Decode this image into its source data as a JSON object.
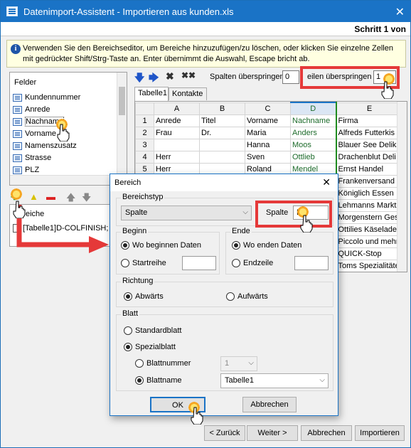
{
  "window": {
    "title": "Datenimport-Assistent -  Importieren aus  kunden.xls",
    "close": "✕",
    "step": "Schritt 1 von"
  },
  "info": {
    "text": "Verwenden Sie den Bereichseditor, um Bereiche hinzuzufügen/zu löschen, oder klicken Sie einzelne Zellen mit gedrückter Shift/Strg-Taste an. Enter übernimmt die Auswahl, Escape bricht ab."
  },
  "felder": {
    "header": "Felder",
    "items": [
      "Kundennummer",
      "Anrede",
      "Nachname",
      "Vorname",
      "Namenszusatz",
      "Strasse",
      "PLZ"
    ]
  },
  "bereiche": {
    "header": "eiche",
    "row": "[Tabelle1]D-COLFINISH;"
  },
  "toolbar": {
    "spalten_label": "Spalten überspringen",
    "spalten_value": "0",
    "zeilen_label": "eilen überspringen",
    "zeilen_value": "1"
  },
  "tabs": [
    "Tabelle1",
    "Kontakte"
  ],
  "grid": {
    "columns": [
      "A",
      "B",
      "C",
      "D",
      "E"
    ],
    "rows": [
      {
        "n": "1",
        "cells": [
          "Anrede",
          "Titel",
          "Vorname",
          "Nachname",
          "Firma"
        ]
      },
      {
        "n": "2",
        "cells": [
          "Frau",
          "Dr.",
          "Maria",
          "Anders",
          "Alfreds Futterkis"
        ]
      },
      {
        "n": "3",
        "cells": [
          "",
          "",
          "Hanna",
          "Moos",
          "Blauer See Delika"
        ]
      },
      {
        "n": "4",
        "cells": [
          "Herr",
          "",
          "Sven",
          "Ottlieb",
          "Drachenblut Deli"
        ]
      },
      {
        "n": "5",
        "cells": [
          "Herr",
          "",
          "Roland",
          "Mendel",
          "Ernst Handel"
        ]
      },
      {
        "n": "",
        "cells": [
          "",
          "",
          "",
          "",
          "Frankenversand"
        ]
      },
      {
        "n": "",
        "cells": [
          "",
          "",
          "",
          "",
          "Königlich Essen"
        ]
      },
      {
        "n": "",
        "cells": [
          "",
          "",
          "",
          "",
          "Lehmanns Markt"
        ]
      },
      {
        "n": "",
        "cells": [
          "",
          "",
          "",
          "",
          "Morgenstern Ges"
        ]
      },
      {
        "n": "",
        "cells": [
          "",
          "",
          "",
          "",
          "Ottilies Käselade"
        ]
      },
      {
        "n": "",
        "cells": [
          "",
          "",
          "",
          "",
          "Piccolo und mehr"
        ]
      },
      {
        "n": "",
        "cells": [
          "",
          "",
          "",
          "",
          "QUICK-Stop"
        ]
      },
      {
        "n": "",
        "cells": [
          "",
          "",
          "",
          "",
          "Toms Spezialitäte"
        ]
      }
    ]
  },
  "dialog": {
    "title": "Bereich",
    "close": "✕",
    "bereichstyp_label": "Bereichstyp",
    "bereichstyp_value": "Spalte",
    "spalte_label": "Spalte",
    "spalte_value": "D",
    "beginn_label": "Beginn",
    "beginn_opt1": "Wo beginnen Daten",
    "beginn_opt2": "Startreihe",
    "ende_label": "Ende",
    "ende_opt1": "Wo enden Daten",
    "ende_opt2": "Endzeile",
    "richtung_label": "Richtung",
    "richtung_opt1": "Abwärts",
    "richtung_opt2": "Aufwärts",
    "blatt_label": "Blatt",
    "blatt_opt1": "Standardblatt",
    "blatt_opt2": "Spezialblatt",
    "blattnummer_label": "Blattnummer",
    "blattnummer_value": "1",
    "blattname_label": "Blattname",
    "blattname_value": "Tabelle1",
    "ok": "OK",
    "abbrechen": "Abbrechen"
  },
  "buttons": {
    "zurueck": "< Zurück",
    "weiter": "Weiter >",
    "abbrechen": "Abbrechen",
    "importieren": "Importieren"
  },
  "colors": {
    "titlebar": "#1a73c6",
    "highlight": "#e53939",
    "selected_column": "#1f8c1f"
  }
}
